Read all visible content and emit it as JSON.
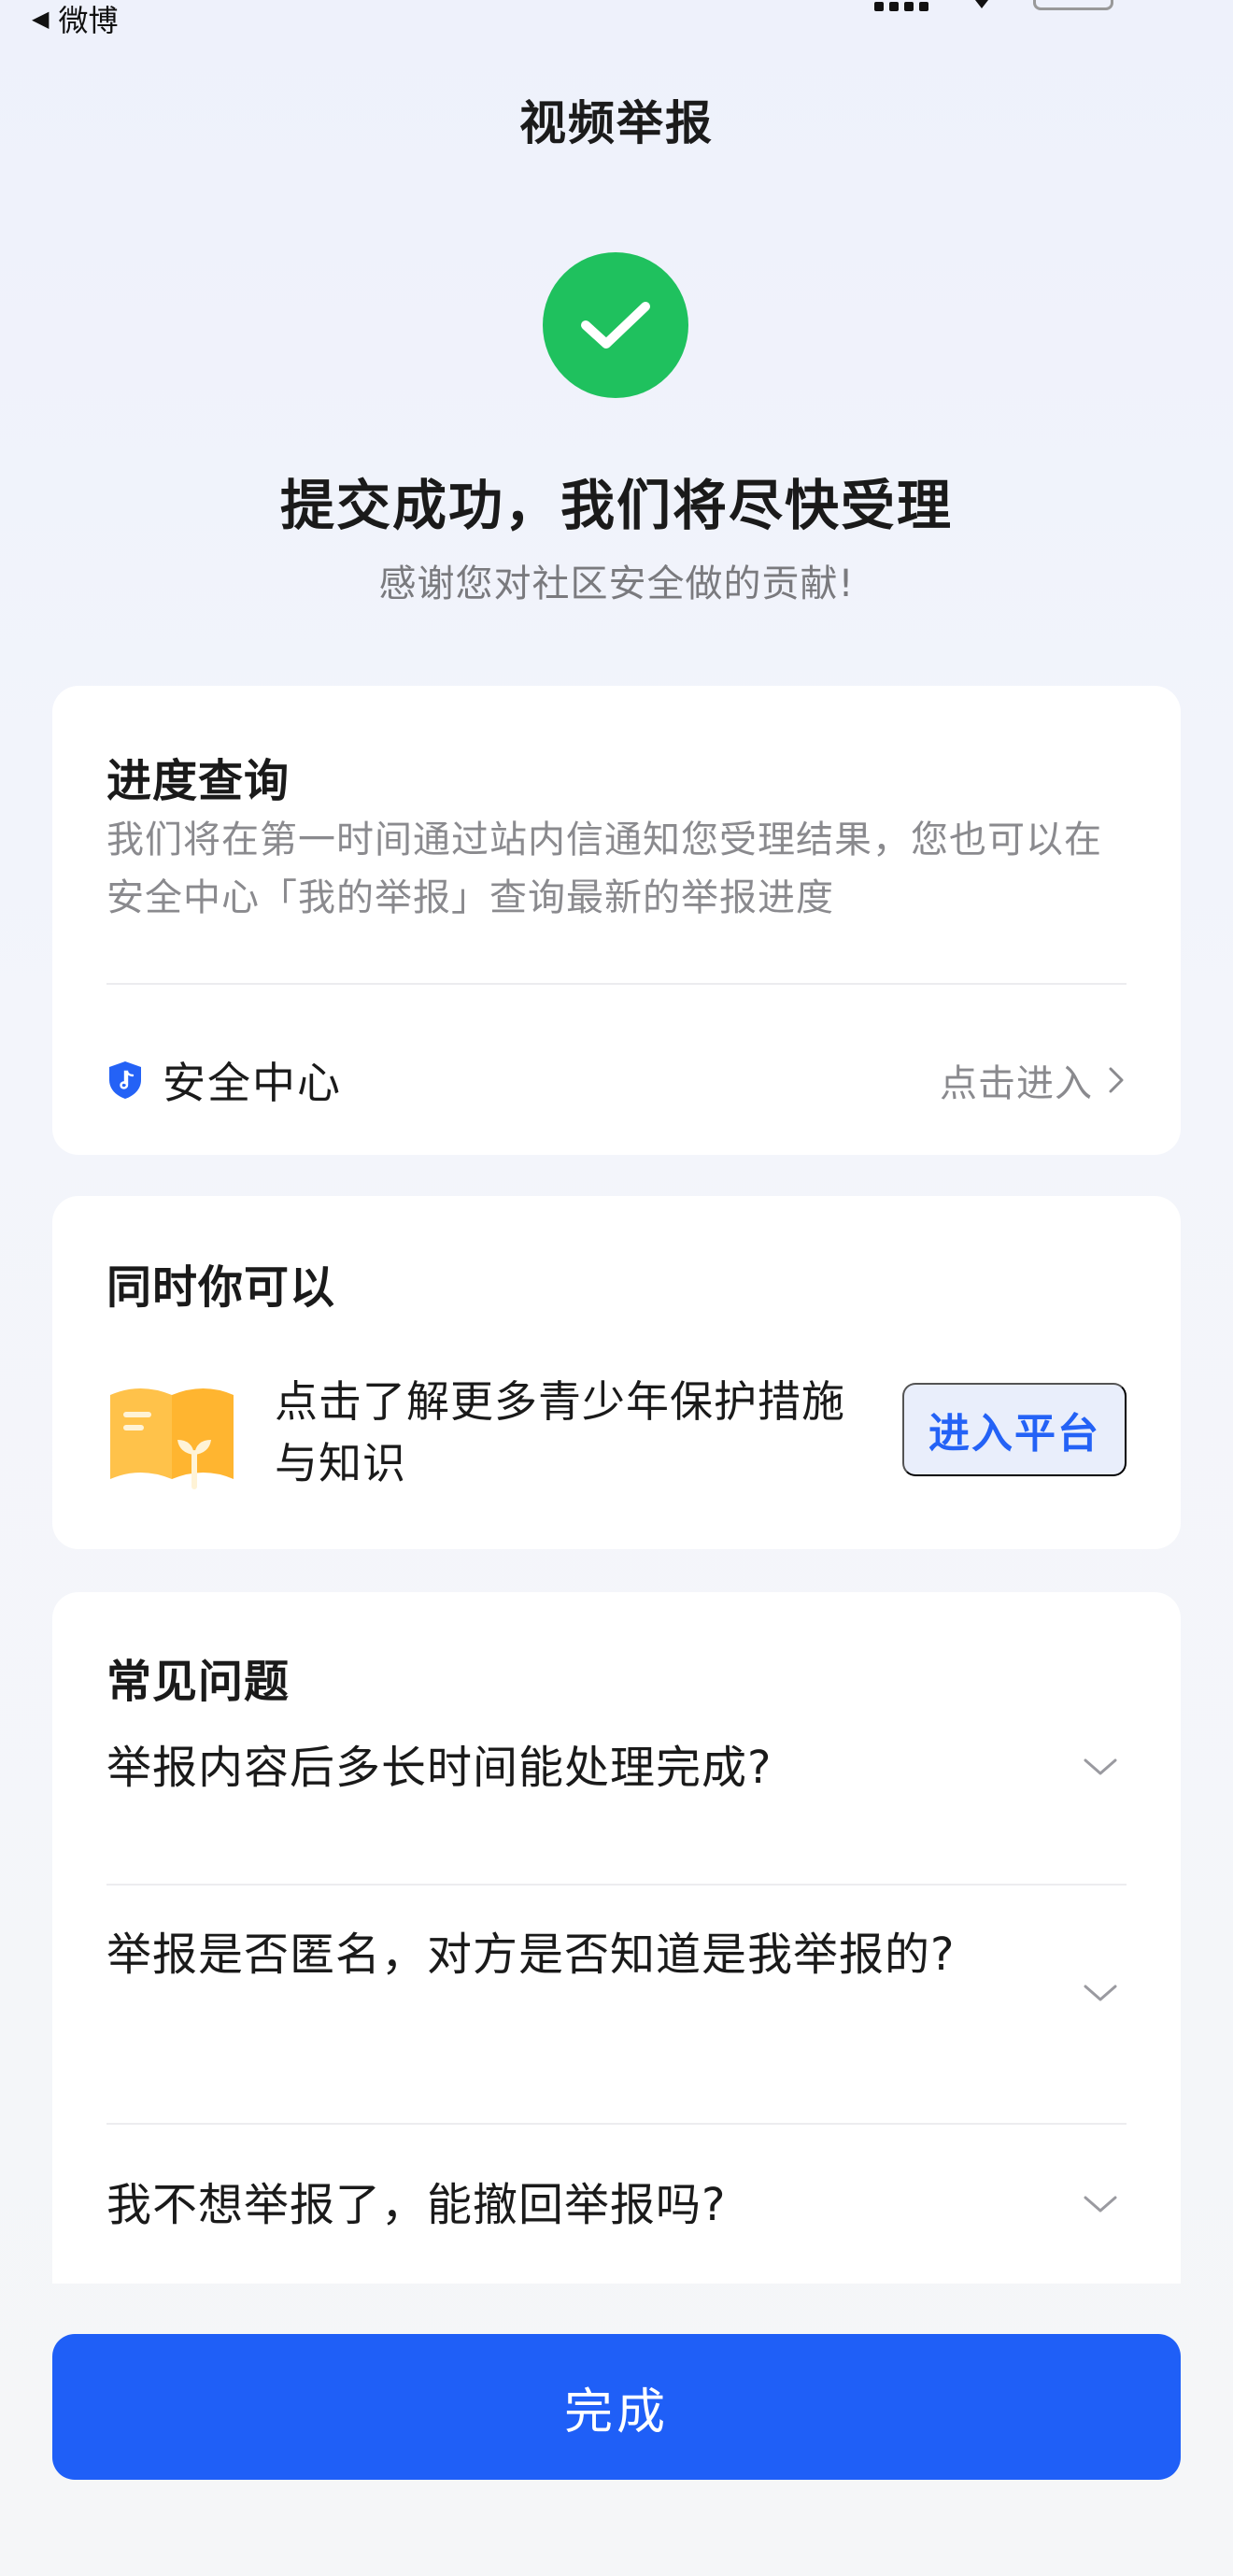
{
  "status_bar": {
    "back_app_label": "微博"
  },
  "nav": {
    "title": "视频举报"
  },
  "result": {
    "headline": "提交成功，我们将尽快受理",
    "subline": "感谢您对社区安全做的贡献!"
  },
  "progress_card": {
    "title": "进度查询",
    "description": "我们将在第一时间通过站内信通知您受理结果，您也可以在安全中心「我的举报」查询最新的举报进度",
    "safety_center_label": "安全中心",
    "enter_link": "点击进入"
  },
  "also_card": {
    "title": "同时你可以",
    "promo_text": "点击了解更多青少年保护措施与知识",
    "button_label": "进入平台"
  },
  "faq_card": {
    "title": "常见问题",
    "items": [
      {
        "question": "举报内容后多长时间能处理完成?"
      },
      {
        "question": "举报是否匿名，对方是否知道是我举报的?"
      },
      {
        "question": "我不想举报了，能撤回举报吗?"
      }
    ]
  },
  "footer": {
    "done_label": "完成"
  },
  "colors": {
    "accent": "#1f5ff7",
    "success": "#1fc15e",
    "link": "#2462f6"
  }
}
